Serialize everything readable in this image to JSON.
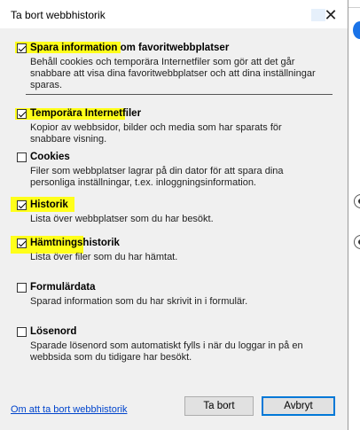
{
  "dialog": {
    "title": "Ta bort webbhistorik",
    "close_symbol": "✕",
    "items": [
      {
        "label": "Spara information om favoritwebbplatser",
        "description": "Behåll cookies och temporära Internetfiler som gör att det går snabbare att visa dina favoritwebbplatser och att dina inställningar sparas.",
        "checked": true
      },
      {
        "label": "Temporära Internetfiler",
        "description": "Kopior av webbsidor, bilder och media som har sparats för snabbare visning.",
        "checked": true
      },
      {
        "label": "Cookies",
        "description": "Filer som webbplatser lagrar på din dator för att spara dina personliga inställningar, t.ex. inloggningsinformation.",
        "checked": false
      },
      {
        "label": "Historik",
        "description": "Lista över webbplatser som du har besökt.",
        "checked": true
      },
      {
        "label": "Hämtningshistorik",
        "description": "Lista över filer som du har hämtat.",
        "checked": true
      },
      {
        "label": "Formulärdata",
        "description": "Sparad information som du har skrivit in i formulär.",
        "checked": false
      },
      {
        "label": "Lösenord",
        "description": "Sparade lösenord som automatiskt fylls i när du loggar in på en webbsida som du tidigare har besökt.",
        "checked": false
      }
    ],
    "link": "Om att ta bort webbhistorik",
    "delete_button": "Ta bort",
    "cancel_button": "Avbryt"
  },
  "colors": {
    "highlight": "#ffff1a",
    "dialog_bg": "#f0f0f0",
    "link": "#0044cc",
    "focus_border": "#0078d7",
    "background_accent": "#1a73e8"
  }
}
